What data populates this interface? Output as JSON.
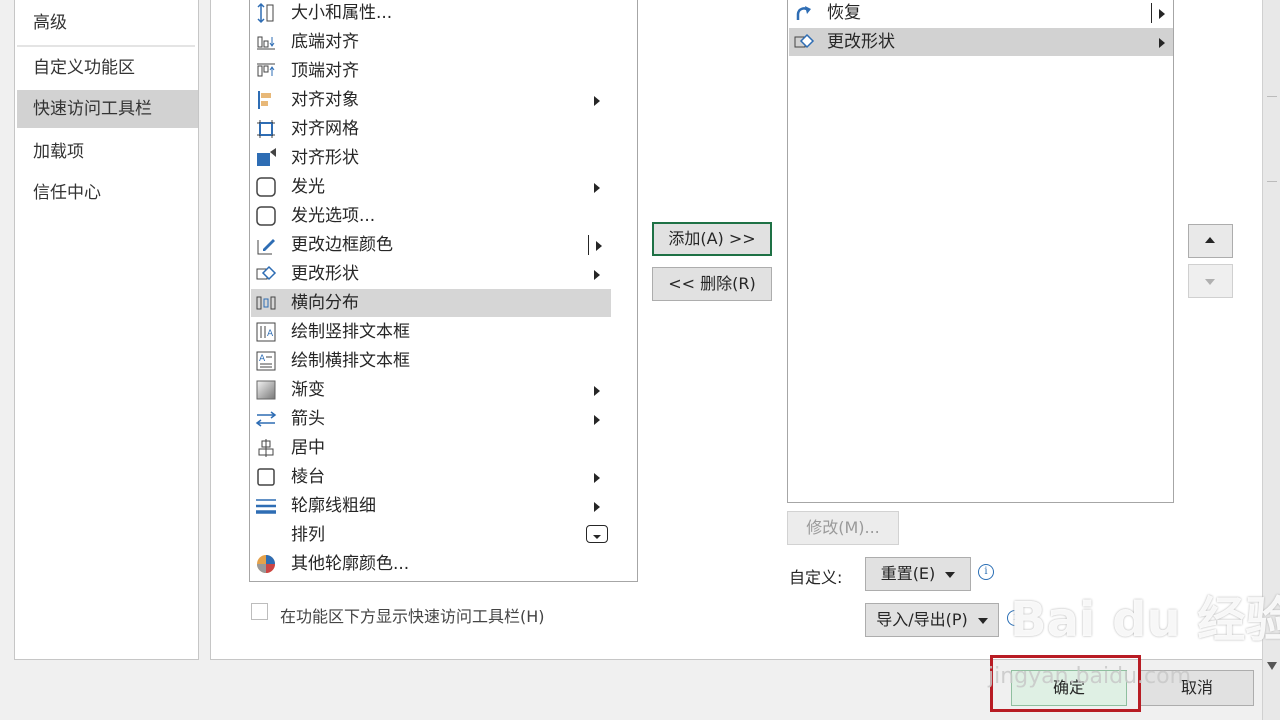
{
  "nav": {
    "items": [
      {
        "label": "高级"
      },
      {
        "label": "自定义功能区"
      },
      {
        "label": "快速访问工具栏",
        "selected": true
      },
      {
        "label": "加载项"
      },
      {
        "label": "信任中心"
      }
    ]
  },
  "commands": {
    "items": [
      {
        "label": "大小和属性...",
        "icon": "size-properties-icon"
      },
      {
        "label": "底端对齐",
        "icon": "align-bottom-icon"
      },
      {
        "label": "顶端对齐",
        "icon": "align-top-icon"
      },
      {
        "label": "对齐对象",
        "icon": "align-objects-icon"
      },
      {
        "label": "对齐网格",
        "icon": "snap-grid-icon"
      },
      {
        "label": "对齐形状",
        "icon": "snap-shape-icon"
      },
      {
        "label": "发光",
        "icon": "glow-icon"
      },
      {
        "label": "发光选项...",
        "icon": "glow-options-icon"
      },
      {
        "label": "更改边框颜色",
        "icon": "border-color-icon"
      },
      {
        "label": "更改形状",
        "icon": "change-shape-icon"
      },
      {
        "label": "横向分布",
        "icon": "distribute-horizontal-icon"
      },
      {
        "label": "绘制竖排文本框",
        "icon": "vertical-textbox-icon"
      },
      {
        "label": "绘制横排文本框",
        "icon": "horizontal-textbox-icon"
      },
      {
        "label": "渐变",
        "icon": "gradient-icon"
      },
      {
        "label": "箭头",
        "icon": "arrow-icon"
      },
      {
        "label": "居中",
        "icon": "center-icon"
      },
      {
        "label": "棱台",
        "icon": "bevel-icon"
      },
      {
        "label": "轮廓线粗细",
        "icon": "outline-weight-icon"
      },
      {
        "label": "排列",
        "icon": "arrange-icon"
      },
      {
        "label": "其他轮廓颜色...",
        "icon": "more-outline-colors-icon"
      }
    ]
  },
  "buttons": {
    "add": "添加(A) >>",
    "remove": "<< 删除(R)",
    "modify": "修改(M)...",
    "reset": "重置(E)",
    "import_export": "导入/导出(P)",
    "ok": "确定",
    "cancel": "取消"
  },
  "qat": {
    "items": [
      {
        "label": "恢复",
        "icon": "redo-icon"
      },
      {
        "label": "更改形状",
        "icon": "change-shape-icon",
        "selected": true
      }
    ]
  },
  "labels": {
    "customize": "自定义:",
    "show_below_ribbon": "在功能区下方显示快速访问工具栏(H)"
  },
  "watermark": {
    "brand": "Bai du 经验",
    "url": "jingyan.baidu.com"
  },
  "colors": {
    "accent_green": "#1e7145",
    "highlight_red": "#b81c24",
    "icon_blue": "#2e6db4"
  }
}
